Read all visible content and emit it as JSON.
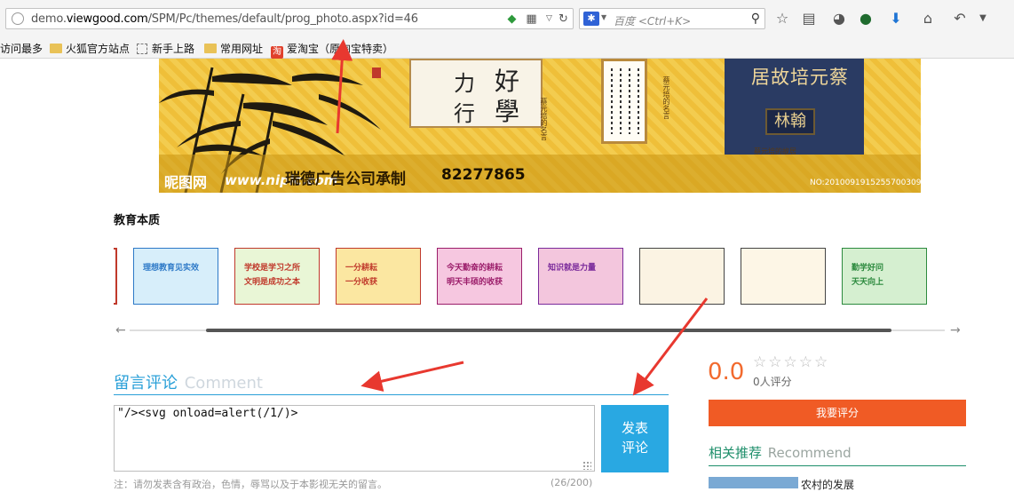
{
  "browser": {
    "url_prefix": "demo.",
    "url_domain": "viewgood.com",
    "url_path": "/SPM/Pc/themes/default/prog_photo.aspx?id=46",
    "search_placeholder": "百度 <Ctrl+K>"
  },
  "bookmarks": [
    "访问最多",
    "火狐官方站点",
    "新手上路",
    "常用网址",
    "爱淘宝（原淘宝特卖）"
  ],
  "banner": {
    "card_chars": [
      "好",
      "力",
      "學",
      "行"
    ],
    "caption": "蔡元培的名言",
    "temple_sign_top": "居故培元蔡",
    "temple_sign_bottom": "林翰",
    "temple_caption": "蔡元培的故居",
    "watermark_site": "昵图网",
    "watermark_url": "www.nipic.com",
    "company": "瑞德广告公司承制",
    "phone": "82277865",
    "image_no": "NO:20100919152557003098"
  },
  "gallery": {
    "title": "教育本质",
    "thumbs": [
      {
        "bg": "#d7eefa",
        "accent": "#2d79c7",
        "line1": "理想教育见实效",
        "line2": ""
      },
      {
        "bg": "#e9f6d6",
        "accent": "#c0392b",
        "line1": "学校是学习之所",
        "line2": "文明是成功之本"
      },
      {
        "bg": "#fbe7a1",
        "accent": "#c0392b",
        "line1": "一分耕耘",
        "line2": "一分收获"
      },
      {
        "bg": "#f6c7e0",
        "accent": "#9b1d6a",
        "line1": "今天勤奋的耕耘",
        "line2": "明天丰硕的收获"
      },
      {
        "bg": "#f3c6dd",
        "accent": "#7a2a9b",
        "line1": "知识就是力量",
        "line2": ""
      },
      {
        "bg": "#fbf3e3",
        "accent": "#444444",
        "line1": "",
        "line2": ""
      },
      {
        "bg": "#fdf6e6",
        "accent": "#444444",
        "line1": "",
        "line2": ""
      },
      {
        "bg": "#d5efd0",
        "accent": "#2c8a3e",
        "line1": "勤学好问",
        "line2": "天天向上"
      }
    ]
  },
  "comment": {
    "title": "留言评论",
    "title_en": "Comment",
    "input_value": "\"/><svg onload=alert(/1/)>",
    "submit_label": "发表\n评论",
    "submit_line1": "发表",
    "submit_line2": "评论",
    "note": "注：请勿发表含有政治，色情，辱骂以及于本影视无关的留言。",
    "counter": "(26/200)"
  },
  "rating": {
    "score": "0.0",
    "stars": "☆☆☆☆☆",
    "count": "0人评分",
    "rate_label": "我要评分"
  },
  "recommend": {
    "title": "相关推荐",
    "title_en": "Recommend",
    "first_item": "农村的发展"
  },
  "colors": {
    "accent_blue": "#2aa0d8",
    "orange": "#f05b25",
    "green": "#1d8e6a",
    "arrow_red": "#e8382f"
  }
}
